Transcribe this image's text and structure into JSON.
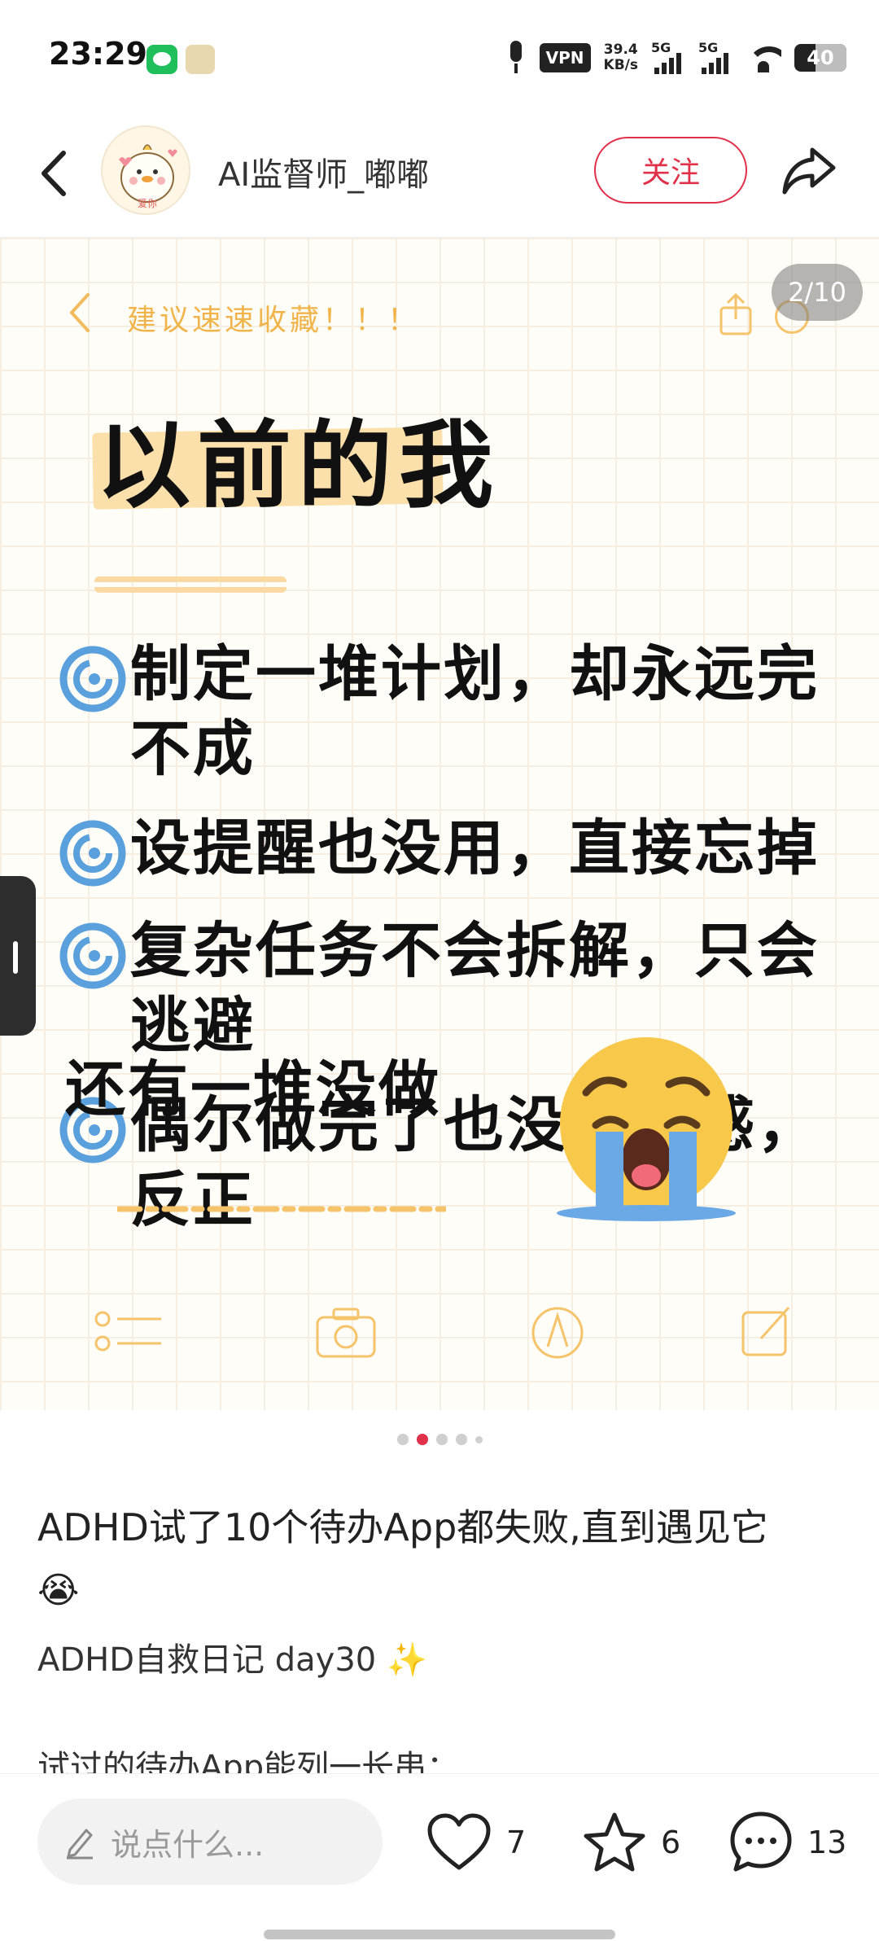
{
  "status_bar": {
    "time": "23:29",
    "vpn_label": "VPN",
    "speed_value": "39.4",
    "speed_unit": "KB/s",
    "signal1_label": "5G",
    "signal2_label": "5G",
    "battery": "40"
  },
  "header": {
    "username": "AI监督师_嘟嘟",
    "follow_label": "关注",
    "avatar_text": "爱你"
  },
  "note_image": {
    "page_counter": "2/10",
    "header_text": "建议速速收藏！！！",
    "title": "以前的我",
    "bullets": [
      "制定一堆计划，却永远完不成",
      "设提醒也没用，直接忘掉",
      "复杂任务不会拆解，只会逃避",
      "偶尔做完了也没成就感，反正"
    ],
    "bullet_continuation": "还有一堆没做"
  },
  "pagination": {
    "total_dots": 5,
    "active_index": 1
  },
  "post": {
    "title": "ADHD试了10个待办App都失败,直到遇见它",
    "title_emoji": "😭",
    "subtitle": "ADHD自救日记 day30",
    "subtitle_emoji": "✨",
    "body_first_line": "试过的待办App能列一长串："
  },
  "bottom_bar": {
    "comment_placeholder": "说点什么...",
    "likes": "7",
    "favorites": "6",
    "comments": "13"
  },
  "colors": {
    "accent": "#e0304a",
    "note_orange": "#f0b44b",
    "highlight": "#fbe0ac",
    "bullet_blue": "#5aa0dc"
  }
}
